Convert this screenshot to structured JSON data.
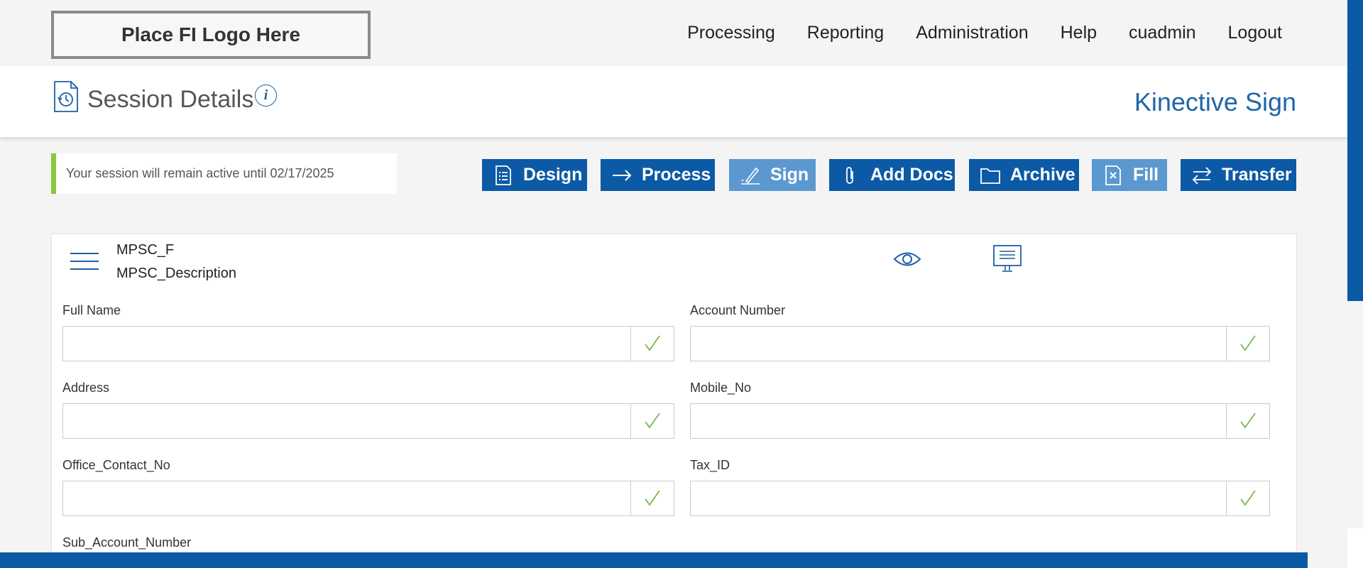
{
  "header": {
    "logo_text": "Place FI Logo Here",
    "nav": [
      "Processing",
      "Reporting",
      "Administration",
      "Help",
      "cuadmin",
      "Logout"
    ]
  },
  "page": {
    "title": "Session Details",
    "info_glyph": "i",
    "brand": "Kinective Sign",
    "icon": "history-document-icon"
  },
  "notice": {
    "text": "Your session will remain active until 02/17/2025"
  },
  "toolbar": [
    {
      "label": "Design",
      "icon": "list-document-icon",
      "active": true
    },
    {
      "label": "Process",
      "icon": "arrow-right-icon",
      "active": true
    },
    {
      "label": "Sign",
      "icon": "pen-icon",
      "active": false
    },
    {
      "label": "Add Docs",
      "icon": "paperclip-icon",
      "active": true
    },
    {
      "label": "Archive",
      "icon": "folder-icon",
      "active": true
    },
    {
      "label": "Fill",
      "icon": "fill-document-icon",
      "active": false
    },
    {
      "label": "Transfer",
      "icon": "transfer-arrows-icon",
      "active": true
    }
  ],
  "document": {
    "name": "MPSC_F",
    "description": "MPSC_Description"
  },
  "fields": [
    {
      "label": "Full Name",
      "value": ""
    },
    {
      "label": "Account Number",
      "value": ""
    },
    {
      "label": "Address",
      "value": ""
    },
    {
      "label": "Mobile_No",
      "value": ""
    },
    {
      "label": "Office_Contact_No",
      "value": ""
    },
    {
      "label": "Tax_ID",
      "value": ""
    },
    {
      "label": "Sub_Account_Number",
      "value": ""
    }
  ],
  "colors": {
    "primary": "#0c5aa6",
    "primary_light": "#5b98cf",
    "brand_text": "#1f66aa",
    "notice_accent": "#8cc63f",
    "check_green": "#7ab648"
  }
}
